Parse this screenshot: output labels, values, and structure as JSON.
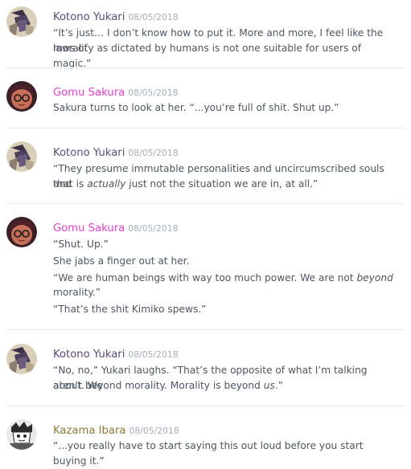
{
  "colors": {
    "kotono": "#5b4a7a",
    "gomu": "#e03fd1",
    "kazama": "#8a7a38",
    "text": "#4f5660",
    "timestamp": "#a7aeb6",
    "divider": "#e8e9eb"
  },
  "messages": [
    {
      "author": "Kotono Yukari",
      "timestamp": "08/05/2018",
      "avatar_icon": "kotono-avatar-icon",
      "lines": [
        "“It’s just… I don’t know how to put it. More and more, I feel like the laws of",
        "morality as dictated by humans is not one suitable for users of magic.”"
      ]
    },
    {
      "author": "Gomu Sakura",
      "timestamp": "08/05/2018",
      "avatar_icon": "gomu-avatar-icon",
      "lines": [
        "Sakura turns to look at her. “...you’re full of shit. Shut up.”"
      ]
    },
    {
      "author": "Kotono Yukari",
      "timestamp": "08/05/2018",
      "avatar_icon": "kotono-avatar-icon",
      "lines": [
        "“They presume immutable personalities and uncircumscribed souls and",
        "that is actually just not the situation we are in, at all.”"
      ]
    },
    {
      "author": "Gomu Sakura",
      "timestamp": "08/05/2018",
      "avatar_icon": "gomu-avatar-icon",
      "lines": [
        "“Shut. Up.”",
        "She jabs a finger out at her.",
        "“We are human beings with way too much power. We are not beyond",
        "morality.”",
        "“That’s the shit Kimiko spews.”"
      ]
    },
    {
      "author": "Kotono Yukari",
      "timestamp": "08/05/2018",
      "avatar_icon": "kotono-avatar-icon",
      "lines": [
        "“No, no,” Yukari laughs. “That’s the opposite of what I’m talking about. We",
        "aren’t beyond morality. Morality is beyond us.”"
      ]
    },
    {
      "author": "Kazama Ibara",
      "timestamp": "08/05/2018",
      "avatar_icon": "kazama-avatar-icon",
      "lines": [
        "“...you really have to start saying this out loud before you start buying it.”"
      ]
    }
  ]
}
